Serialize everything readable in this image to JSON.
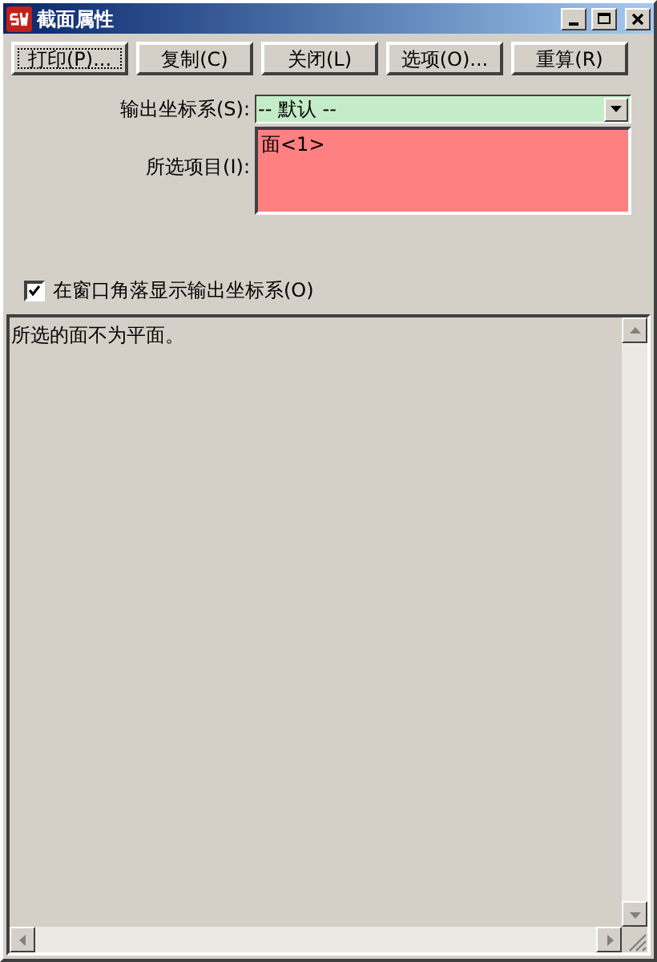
{
  "window": {
    "title": "截面属性"
  },
  "buttons": [
    {
      "label": "打印(P)...",
      "focused": true
    },
    {
      "label": "复制(C)",
      "focused": false
    },
    {
      "label": "关闭(L)",
      "focused": false
    },
    {
      "label": "选项(O)...",
      "focused": false
    },
    {
      "label": "重算(R)",
      "focused": false
    }
  ],
  "output_coordinate_system": {
    "label": "输出坐标系(S):",
    "value": "-- 默认 --"
  },
  "selected_items": {
    "label": "所选项目(I):",
    "items": [
      "面<1>"
    ]
  },
  "show_in_corner": {
    "label": "在窗口角落显示输出坐标系(O)",
    "checked": true
  },
  "results": {
    "text": "所选的面不为平面。"
  }
}
